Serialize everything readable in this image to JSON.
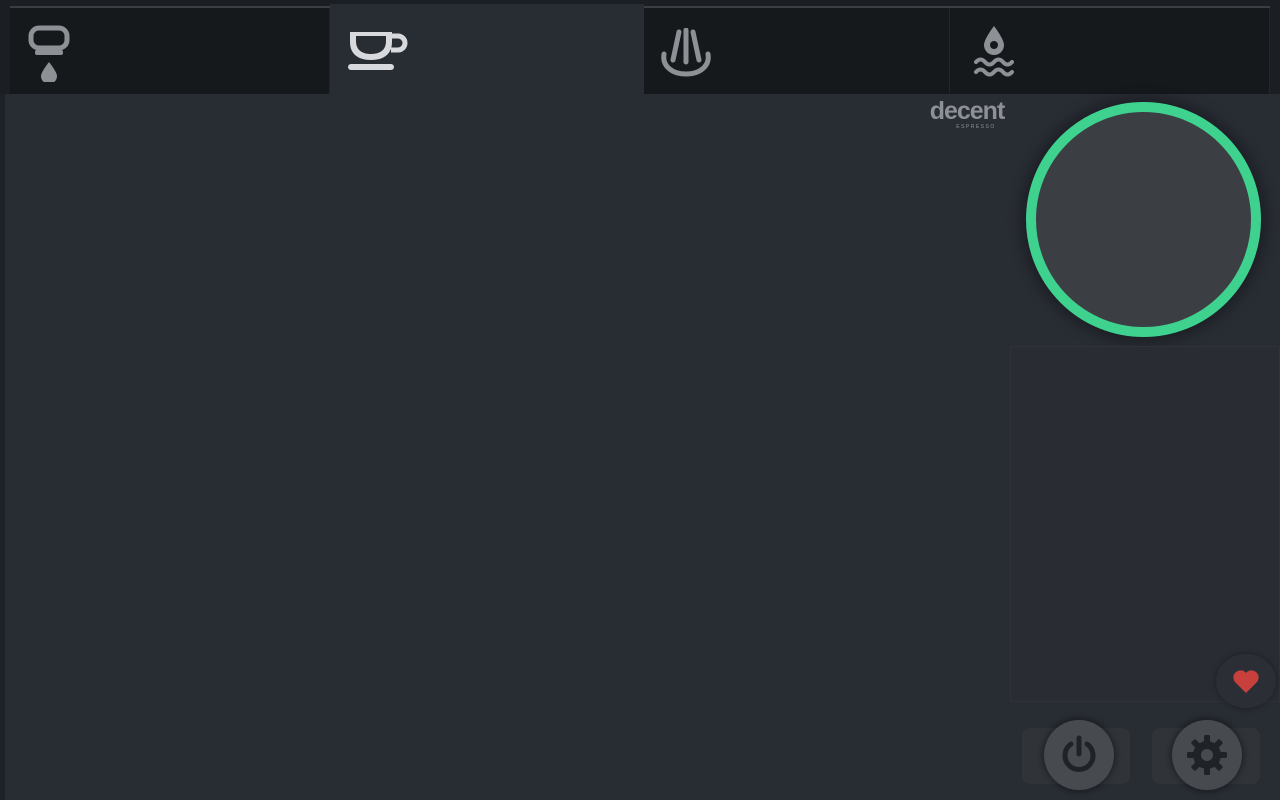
{
  "tabs": [
    {
      "id": "flush",
      "icon": "group-head-drip-icon",
      "active": false
    },
    {
      "id": "espresso",
      "icon": "espresso-cup-icon",
      "active": true
    },
    {
      "id": "steam",
      "icon": "steam-wand-icon",
      "active": false
    },
    {
      "id": "water",
      "icon": "water-drop-waves-icon",
      "active": false
    }
  ],
  "logo": {
    "word": "decent",
    "sub": "ESPRESSO"
  },
  "start_button": {
    "ring_color": "#3fd28f",
    "fill_color": "#3b3f43"
  },
  "favorite": {
    "icon": "heart-icon",
    "color": "#c8403c"
  },
  "controls": [
    {
      "id": "power",
      "icon": "power-icon"
    },
    {
      "id": "settings",
      "icon": "gear-icon"
    }
  ],
  "colors": {
    "background": "#282c33",
    "tabbar": "#16191c",
    "icon_active": "#d7d9dc",
    "icon_inactive": "#8d9196",
    "accent": "#3fd28f"
  }
}
